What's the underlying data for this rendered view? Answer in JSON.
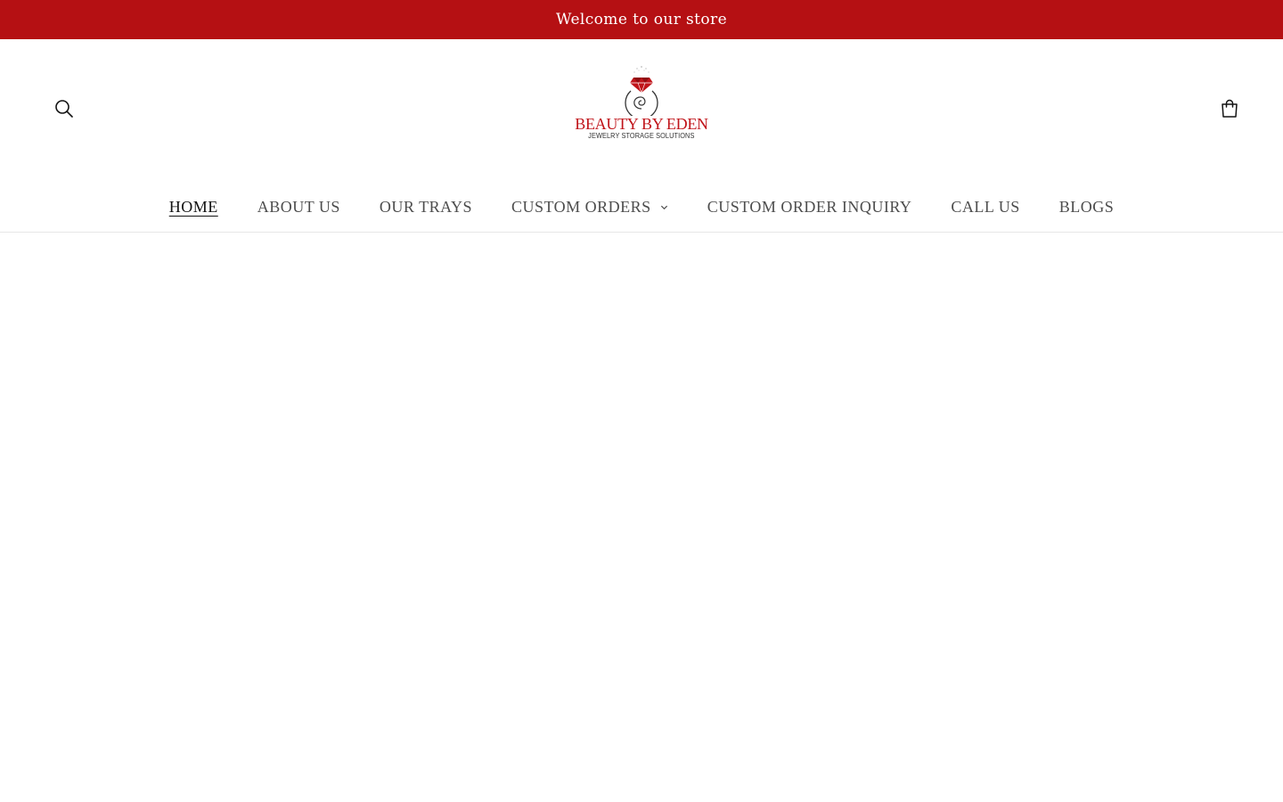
{
  "announcement": {
    "text": "Welcome to our store",
    "background_color": "#b51013"
  },
  "header": {
    "search_icon": "search-icon",
    "cart_icon": "cart-icon",
    "logo": {
      "title": "BEAUTY BY EDEN",
      "subtitle": "JEWELRY STORAGE SOLUTIONS",
      "brand_color": "#c0141a"
    }
  },
  "nav": {
    "items": [
      {
        "label": "HOME",
        "active": true
      },
      {
        "label": "ABOUT US"
      },
      {
        "label": "OUR TRAYS"
      },
      {
        "label": "CUSTOM ORDERS",
        "has_dropdown": true
      },
      {
        "label": "CUSTOM ORDER INQUIRY"
      },
      {
        "label": "CALL US"
      },
      {
        "label": "BLOGS"
      }
    ]
  }
}
